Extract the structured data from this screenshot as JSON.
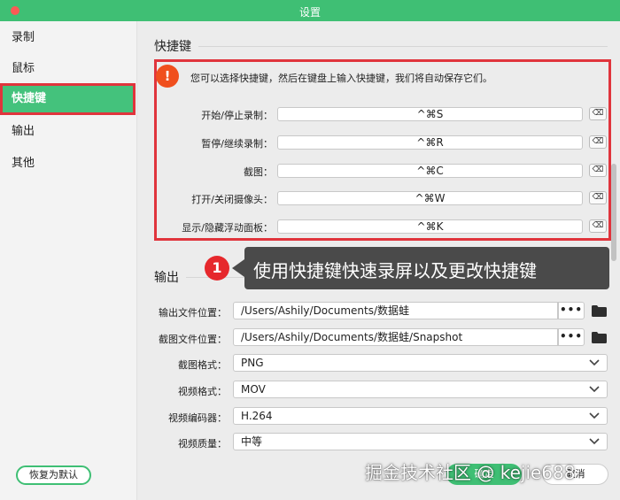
{
  "window": {
    "title": "设置"
  },
  "sidebar": {
    "items": [
      {
        "label": "录制",
        "active": false
      },
      {
        "label": "鼠标",
        "active": false
      },
      {
        "label": "快捷键",
        "active": true
      },
      {
        "label": "输出",
        "active": false
      },
      {
        "label": "其他",
        "active": false
      }
    ],
    "reset_label": "恢复为默认"
  },
  "shortcuts": {
    "title": "快捷键",
    "warning_icon": "!",
    "hint": "您可以选择快捷键，然后在键盘上输入快捷键，我们将自动保存它们。",
    "rows": [
      {
        "label": "开始/停止录制：",
        "value": "^⌘S",
        "clear_icon": "⌫"
      },
      {
        "label": "暂停/继续录制：",
        "value": "^⌘R",
        "clear_icon": "⌫"
      },
      {
        "label": "截图：",
        "value": "^⌘C",
        "clear_icon": "⌫"
      },
      {
        "label": "打开/关闭摄像头：",
        "value": "^⌘W",
        "clear_icon": "⌫"
      },
      {
        "label": "显示/隐藏浮动面板：",
        "value": "^⌘K",
        "clear_icon": "⌫"
      }
    ]
  },
  "callout": {
    "number": "1",
    "text": "使用快捷键快速录屏以及更改快捷键"
  },
  "output": {
    "title": "输出",
    "output_location": {
      "label": "输出文件位置：",
      "value": "/Users/Ashily/Documents/数据蛙",
      "browse_label": "•••"
    },
    "screenshot_location": {
      "label": "截图文件位置：",
      "value": "/Users/Ashily/Documents/数据蛙/Snapshot",
      "browse_label": "•••"
    },
    "screenshot_format": {
      "label": "截图格式：",
      "value": "PNG"
    },
    "video_format": {
      "label": "视频格式：",
      "value": "MOV"
    },
    "video_encoder": {
      "label": "视频编码器：",
      "value": "H.264"
    },
    "video_quality": {
      "label": "视频质量：",
      "value": "中等"
    }
  },
  "footer": {
    "confirm_label": "确定",
    "cancel_label": "取消"
  },
  "watermark": "掘金技术社区 @ kejie688",
  "colors": {
    "accent": "#3fbf74",
    "highlight_border": "#e0343c",
    "warning": "#f04f1d",
    "callout_bg": "#4a4a4a"
  }
}
